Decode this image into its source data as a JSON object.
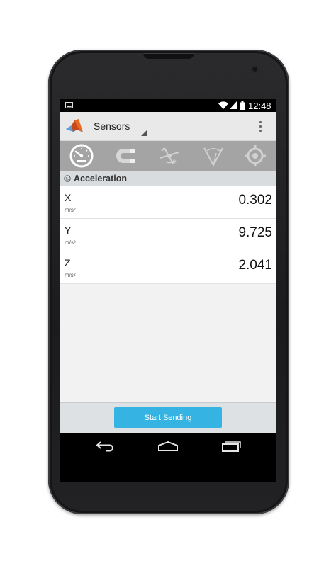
{
  "status_bar": {
    "time": "12:48",
    "icons": [
      "picture-icon",
      "wifi-icon",
      "signal-icon",
      "battery-icon"
    ]
  },
  "action_bar": {
    "app_icon": "matlab-logo-icon",
    "title": "Sensors",
    "overflow_icon": "overflow-menu-icon"
  },
  "tabs": [
    {
      "icon": "speedometer-icon",
      "selected": true
    },
    {
      "icon": "magnet-icon",
      "selected": false
    },
    {
      "icon": "gyroscope-icon",
      "selected": false
    },
    {
      "icon": "orientation-icon",
      "selected": false
    },
    {
      "icon": "position-target-icon",
      "selected": false
    }
  ],
  "section": {
    "icon": "speedometer-small-icon",
    "title": "Acceleration"
  },
  "rows": [
    {
      "label": "X",
      "unit": "m/s²",
      "value": "0.302"
    },
    {
      "label": "Y",
      "unit": "m/s²",
      "value": "9.725"
    },
    {
      "label": "Z",
      "unit": "m/s²",
      "value": "2.041"
    }
  ],
  "bottom": {
    "button_label": "Start Sending"
  },
  "nav": [
    "back-icon",
    "home-icon",
    "recent-apps-icon"
  ],
  "colors": {
    "accent": "#35b4e3",
    "tab_bar": "#a4a4a4",
    "action_bar": "#e9e9e9"
  }
}
